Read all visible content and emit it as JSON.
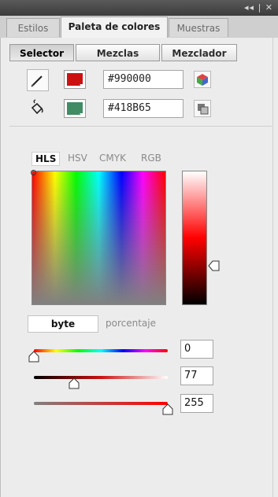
{
  "window": {
    "controls": "◂◂ | ✕"
  },
  "tabs": [
    {
      "label": "Estilos",
      "active": false
    },
    {
      "label": "Paleta de colores",
      "active": true
    },
    {
      "label": "Muestras",
      "active": false
    }
  ],
  "modes_top": [
    {
      "label": "Selector",
      "active": true
    },
    {
      "label": "Mezclas",
      "active": false
    },
    {
      "label": "Mezclador",
      "active": false
    }
  ],
  "stroke": {
    "icon": "pencil-icon",
    "color": "#cc1111",
    "hex": "#990000"
  },
  "fill": {
    "icon": "paint-bucket-icon",
    "color": "#418B65",
    "hex": "#418B65"
  },
  "color_models": [
    {
      "label": "HLS",
      "active": true
    },
    {
      "label": "HSV",
      "active": false
    },
    {
      "label": "CMYK",
      "active": false
    },
    {
      "label": "RGB",
      "active": false
    }
  ],
  "units": {
    "active": "byte",
    "inactive": "porcentaje"
  },
  "sliders": [
    {
      "name": "hue",
      "value": "0",
      "fraction": 0.0
    },
    {
      "name": "lightness",
      "value": "77",
      "fraction": 0.3
    },
    {
      "name": "saturation",
      "value": "255",
      "fraction": 1.0
    }
  ]
}
